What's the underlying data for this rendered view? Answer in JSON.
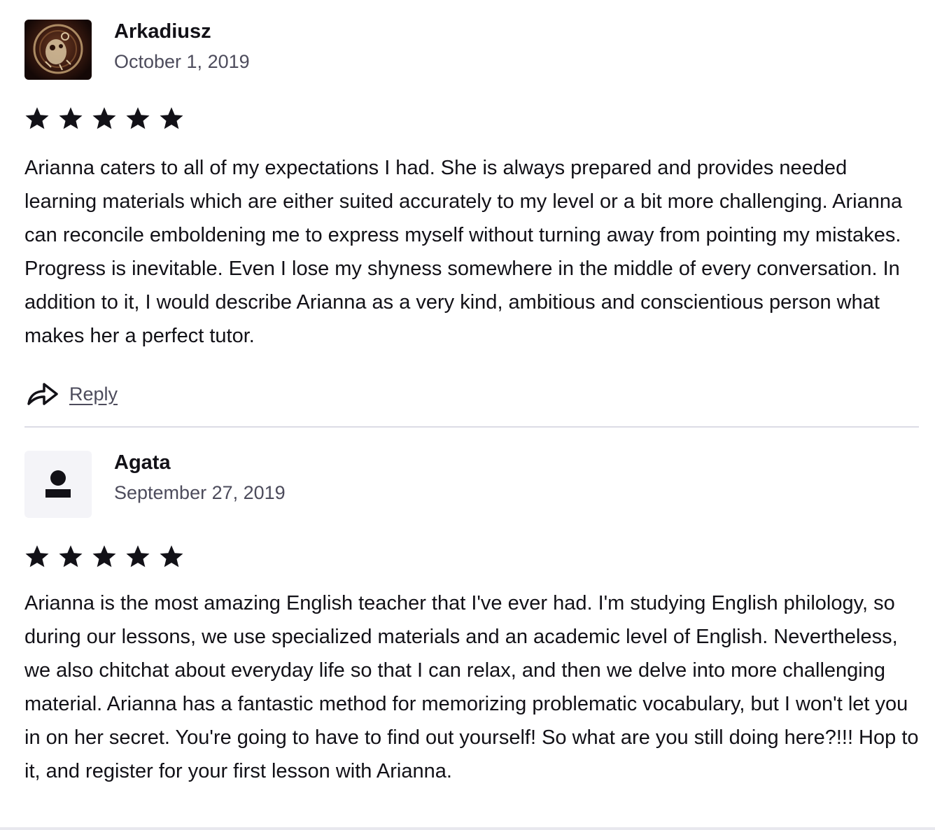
{
  "reviews": [
    {
      "name": "Arkadiusz",
      "date": "October 1, 2019",
      "avatar_icon": "user-photo",
      "rating": 5,
      "text": "Arianna caters to all of my expectations I had. She is always prepared and provides needed learning materials which are either suited accurately to my level or a bit more challenging. Arianna can reconcile emboldening me to express myself without turning away from pointing my mistakes. Progress is inevitable. Even I lose my shyness somewhere in the middle of every conversation. In addition to it, I would describe Arianna as a very kind, ambitious and conscientious person what makes her a perfect tutor.",
      "reply_label": "Reply"
    },
    {
      "name": "Agata",
      "date": "September 27, 2019",
      "avatar_icon": "default-user-icon",
      "rating": 5,
      "text": "Arianna is the most amazing English teacher that I've ever had. I'm studying English philology, so during our lessons, we use specialized materials and an academic level of English. Nevertheless, we also chitchat about everyday life so that I can relax, and then we delve into more challenging material. Arianna has a fantastic method for memorizing problematic vocabulary, but I won't let you in on her secret. You're going to have to find out yourself! So what are you still doing here?!!! Hop to it, and register for your first lesson with Arianna."
    }
  ],
  "colors": {
    "text": "#121117",
    "muted": "#4d4c5c",
    "divider": "#dcdce5",
    "avatar_bg": "#f4f4f8"
  }
}
